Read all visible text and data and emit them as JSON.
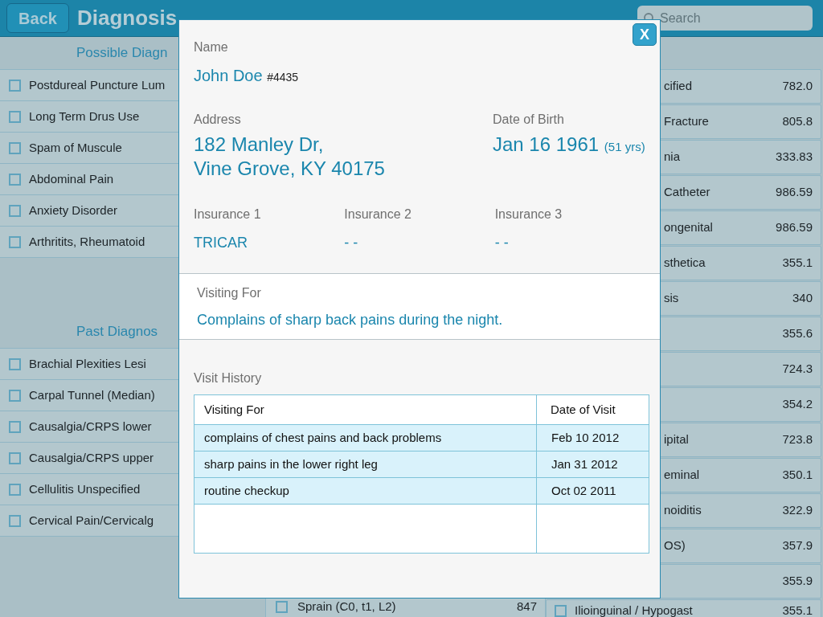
{
  "header": {
    "back": "Back",
    "title": "Diagnosis",
    "search": {
      "placeholder": "Search"
    }
  },
  "possible": {
    "heading": "Possible Diagn",
    "items": [
      {
        "label": "Postdureal Puncture Lum",
        "checked": false
      },
      {
        "label": "Long Term Drus Use",
        "checked": false
      },
      {
        "label": "Spam of Muscule",
        "checked": false
      },
      {
        "label": "Abdominal Pain",
        "checked": false
      },
      {
        "label": "Anxiety Disorder",
        "checked": false
      },
      {
        "label": "Arthritits, Rheumatoid",
        "checked": false
      }
    ]
  },
  "past": {
    "heading": "Past Diagnos",
    "items": [
      {
        "label": "Brachial Plexities Lesi",
        "checked": false
      },
      {
        "label": "Carpal Tunnel (Median)",
        "checked": false
      },
      {
        "label": "Causalgia/CRPS lower",
        "checked": false
      },
      {
        "label": "Causalgia/CRPS upper",
        "checked": false
      },
      {
        "label": "Cellulitis Unspecified",
        "checked": false
      },
      {
        "label": "Cervical Pain/Cervicalg",
        "checked": false
      }
    ]
  },
  "middle": {
    "items": [
      {
        "label": "Sprain (C0, t1, L2)",
        "code": "847",
        "checked": false
      }
    ]
  },
  "right": {
    "items": [
      {
        "kind": "covered",
        "label": "cified",
        "code": "782.0"
      },
      {
        "kind": "covered",
        "label": "Fracture",
        "code": "805.8"
      },
      {
        "kind": "covered",
        "label": "nia",
        "code": "333.83"
      },
      {
        "kind": "covered",
        "label": "Catheter",
        "code": "986.59"
      },
      {
        "kind": "covered",
        "label": "ongenital",
        "code": "986.59"
      },
      {
        "kind": "covered",
        "label": "sthetica",
        "code": "355.1"
      },
      {
        "kind": "covered",
        "label": "sis",
        "code": "340"
      },
      {
        "kind": "covered",
        "code": "355.6"
      },
      {
        "kind": "covered",
        "code": "724.3"
      },
      {
        "kind": "covered",
        "code": "354.2"
      },
      {
        "kind": "covered",
        "label": "ipital",
        "code": "723.8"
      },
      {
        "kind": "covered",
        "label": "eminal",
        "code": "350.1"
      },
      {
        "kind": "covered",
        "label": "noiditis",
        "code": "322.9"
      },
      {
        "kind": "covered",
        "label": "OS)",
        "code": "357.9"
      },
      {
        "kind": "covered",
        "code": "355.9"
      },
      {
        "kind": "full",
        "label": "Ilioinguinal / Hypogast",
        "code": "355.1",
        "checked": false
      }
    ]
  },
  "modal": {
    "close": "X",
    "name_label": "Name",
    "name": "John Doe",
    "name_id": "#4435",
    "address_label": "Address",
    "address_lines": [
      "182 Manley Dr,",
      "Vine Grove, KY 40175"
    ],
    "dob_label": "Date of Birth",
    "dob": "Jan 16 1961",
    "age": "(51 yrs)",
    "insurance": [
      {
        "label": "Insurance 1",
        "value": "TRICAR"
      },
      {
        "label": "Insurance 2",
        "value": "- -"
      },
      {
        "label": "Insurance 3",
        "value": "- -"
      }
    ],
    "visiting_label": "Visiting For",
    "visiting": "Complains of sharp back pains during the night.",
    "history_label": "Visit History",
    "history": {
      "columns": [
        "Visiting For",
        "Date of Visit"
      ],
      "rows": [
        {
          "reason": "complains of chest pains and back problems",
          "date": "Feb 10 2012"
        },
        {
          "reason": "sharp pains in the lower right leg",
          "date": "Jan 31 2012"
        },
        {
          "reason": "routine checkup",
          "date": "Oct 02 2011"
        }
      ]
    }
  }
}
